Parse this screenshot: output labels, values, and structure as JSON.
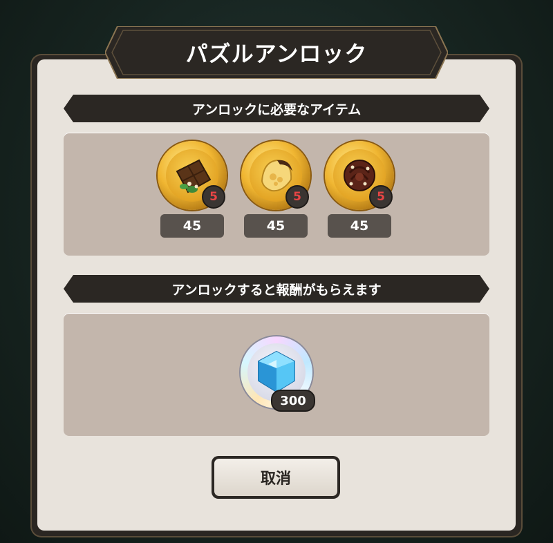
{
  "dialog": {
    "title": "パズルアンロック",
    "required_header": "アンロックに必要なアイテム",
    "reward_header": "アンロックすると報酬がもらえます",
    "cancel_label": "取消"
  },
  "required_items": [
    {
      "icon": "chocolate-bar-icon",
      "level": "5",
      "count": "45"
    },
    {
      "icon": "cookie-sauce-icon",
      "level": "5",
      "count": "45"
    },
    {
      "icon": "chocolate-rose-icon",
      "level": "5",
      "count": "45"
    }
  ],
  "reward": {
    "icon": "diamond-gem-icon",
    "amount": "300"
  },
  "colors": {
    "accent_gold": "#f0b632",
    "banner_dark": "#2b2723",
    "level_red": "#e84545"
  }
}
